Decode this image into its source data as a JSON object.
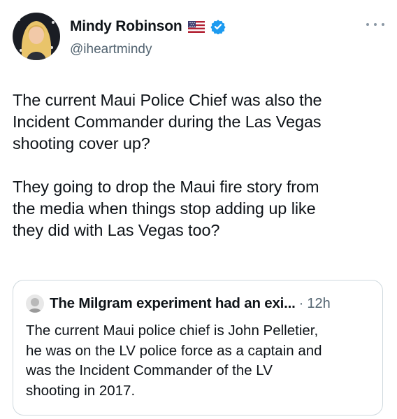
{
  "author": {
    "display_name": "Mindy Robinson",
    "handle": "@iheartmindy",
    "flag_icon": "us-flag-icon",
    "verified_icon": "verified-badge-icon",
    "verified_color": "#1d9bf0"
  },
  "tweet": {
    "text": "The current Maui Police Chief was also the\nIncident Commander during the Las Vegas\nshooting cover up?\n\nThey going to drop the Maui fire story from\nthe media when things stop adding up like\nthey did with Las Vegas too?"
  },
  "quote": {
    "author_name": "The Milgram experiment had an exi...",
    "separator": "·",
    "time": "12h",
    "text": "The current Maui police chief is John Pelletier,\nhe was on the LV police force as a captain and\nwas the Incident Commander of the LV\nshooting in 2017."
  },
  "colors": {
    "text": "#0f1419",
    "secondary": "#536471",
    "border": "#cfd9de"
  }
}
